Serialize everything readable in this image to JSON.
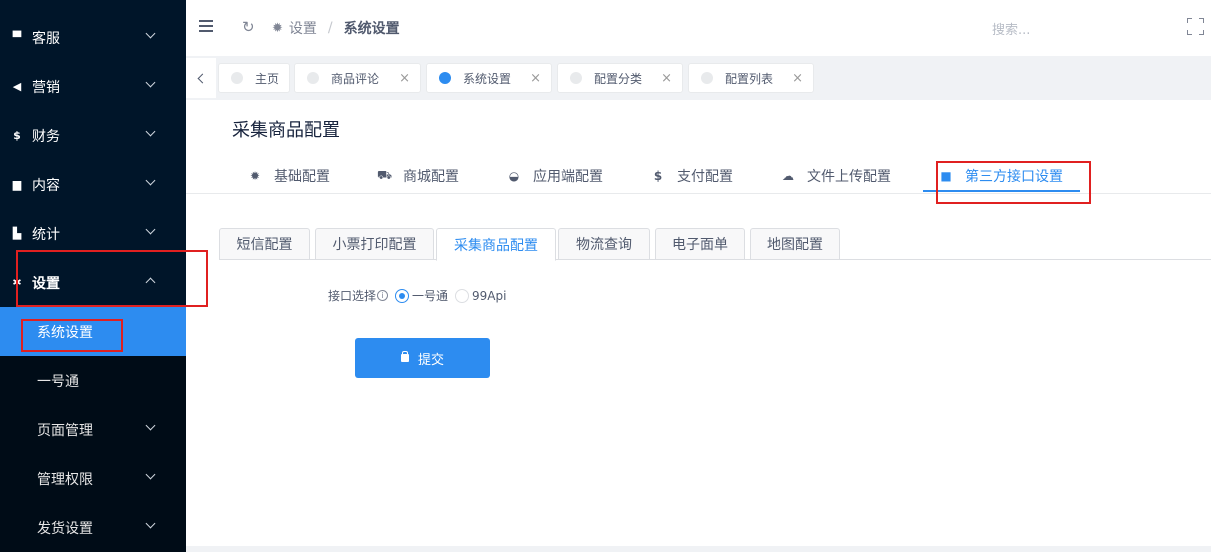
{
  "sidebar": {
    "items": [
      {
        "label": "客服",
        "icon": "chat-icon"
      },
      {
        "label": "营销",
        "icon": "paper-plane-icon"
      },
      {
        "label": "财务",
        "icon": "dollar-icon"
      },
      {
        "label": "内容",
        "icon": "book-icon"
      },
      {
        "label": "统计",
        "icon": "bar-chart-icon"
      },
      {
        "label": "设置",
        "icon": "cog-icon"
      }
    ],
    "subitems": [
      {
        "label": "系统设置"
      },
      {
        "label": "一号通"
      },
      {
        "label": "页面管理"
      },
      {
        "label": "管理权限"
      },
      {
        "label": "发货设置"
      }
    ]
  },
  "header": {
    "breadcrumb_1": "设置",
    "breadcrumb_sep": "/",
    "breadcrumb_2": "系统设置",
    "search_placeholder": "搜索..."
  },
  "page_tabs": [
    {
      "label": "主页"
    },
    {
      "label": "商品评论",
      "close": "×"
    },
    {
      "label": "系统设置",
      "close": "×"
    },
    {
      "label": "配置分类",
      "close": "×"
    },
    {
      "label": "配置列表",
      "close": "×"
    }
  ],
  "content": {
    "title": "采集商品配置",
    "main_tabs": [
      {
        "label": "基础配置",
        "icon": "gear-icon"
      },
      {
        "label": "商城配置",
        "icon": "cart-icon"
      },
      {
        "label": "应用端配置",
        "icon": "app-icon"
      },
      {
        "label": "支付配置",
        "icon": "dollar-icon"
      },
      {
        "label": "文件上传配置",
        "icon": "cloud-upload-icon"
      },
      {
        "label": "第三方接口设置",
        "icon": "briefcase-icon"
      }
    ],
    "sub_tabs": [
      {
        "label": "短信配置"
      },
      {
        "label": "小票打印配置"
      },
      {
        "label": "采集商品配置"
      },
      {
        "label": "物流查询"
      },
      {
        "label": "电子面单"
      },
      {
        "label": "地图配置"
      }
    ],
    "form": {
      "label": "接口选择",
      "info": "i",
      "options": [
        "一号通",
        "99Api"
      ],
      "selected": "一号通"
    },
    "submit_label": "提交"
  },
  "colors": {
    "accent": "#2d8cf0",
    "sidebar_bg": "#001529",
    "highlight": "#e02020"
  }
}
